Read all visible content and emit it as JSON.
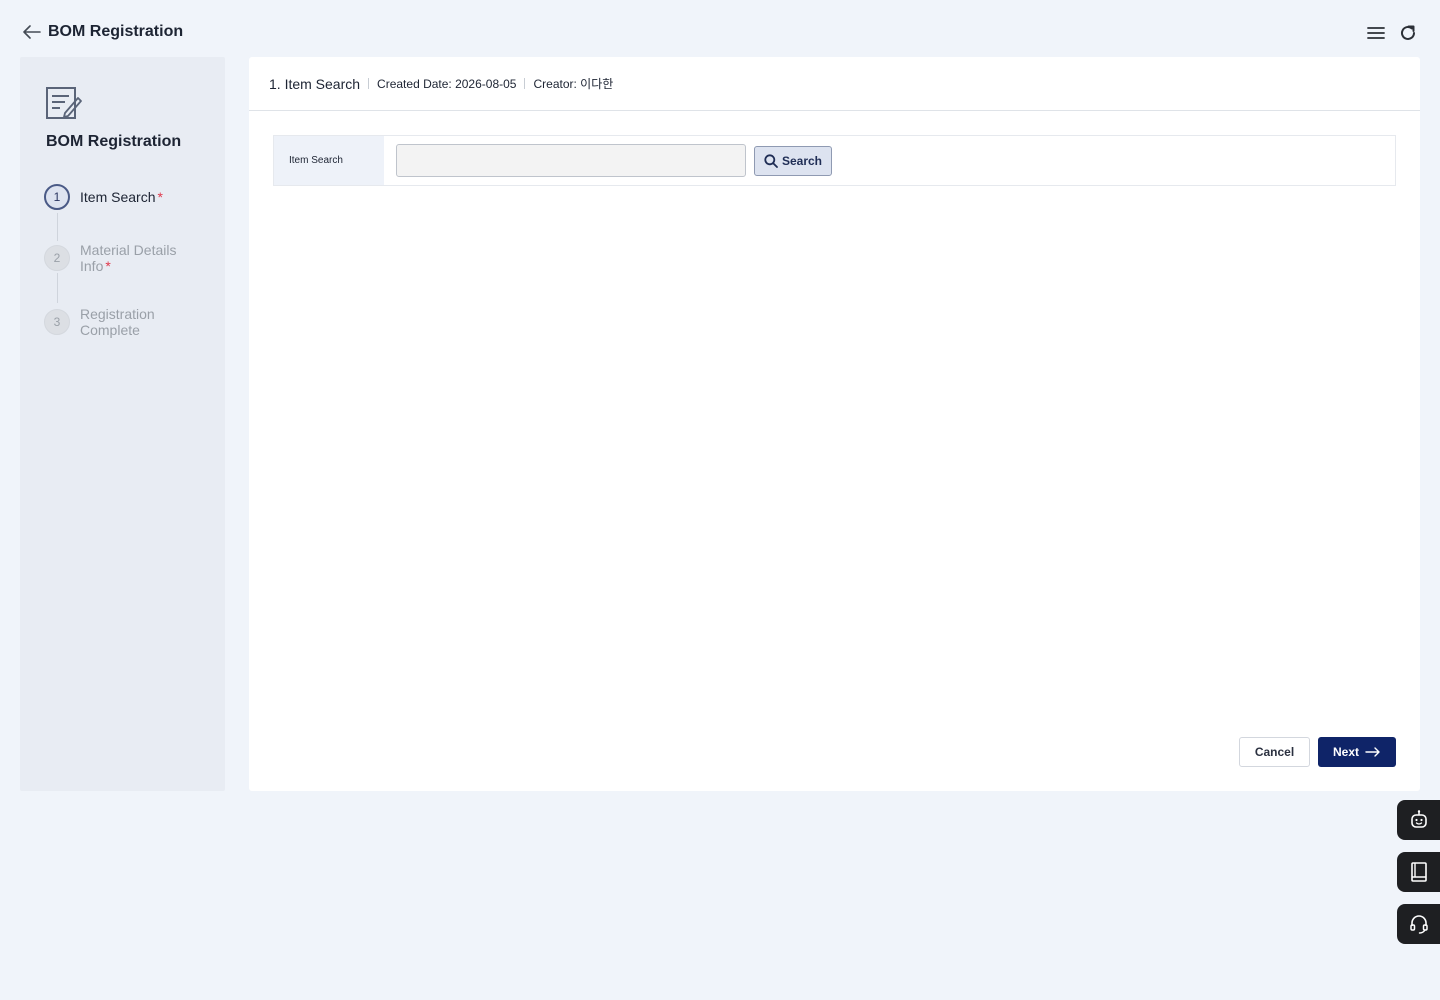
{
  "app": {
    "title": "BOM Registration"
  },
  "steps_panel": {
    "title": "BOM Registration",
    "steps": [
      {
        "number": "1",
        "label": "Item Search",
        "required": "*",
        "state": "active"
      },
      {
        "number": "2",
        "label": "Material Details Info",
        "required": "*",
        "state": "inactive"
      },
      {
        "number": "3",
        "label": "Registration Complete",
        "required": "",
        "state": "inactive"
      }
    ]
  },
  "header": {
    "step_title": "1. Item Search",
    "created_date": "Created Date: 2026-08-05",
    "creator": "Creator: 이다한"
  },
  "search": {
    "label": "Item Search",
    "value": "",
    "placeholder": "",
    "button_label": "Search"
  },
  "footer": {
    "cancel_label": "Cancel",
    "next_label": "Next"
  },
  "icons": {
    "back": "arrow-left-icon",
    "menu": "hamburger-menu-icon",
    "refresh": "refresh-icon",
    "document_edit": "document-edit-icon",
    "search": "magnifier-icon",
    "next": "arrow-right-icon",
    "chatbot": "robot-icon",
    "manual": "book-icon",
    "support": "headset-icon"
  },
  "colors": {
    "primary": "#0f2468",
    "required": "#e0384b",
    "background": "#f0f4fa"
  }
}
